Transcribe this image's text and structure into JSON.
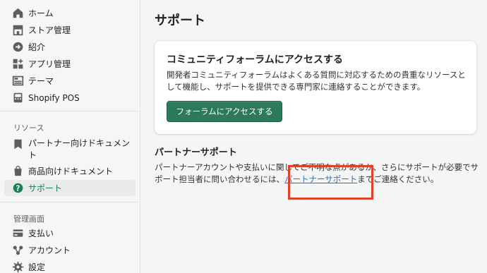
{
  "sidebar": {
    "items": [
      {
        "label": "ホーム",
        "icon": "home-icon"
      },
      {
        "label": "ストア管理",
        "icon": "store-icon"
      },
      {
        "label": "紹介",
        "icon": "referral-icon"
      },
      {
        "label": "アプリ管理",
        "icon": "apps-icon"
      },
      {
        "label": "テーマ",
        "icon": "theme-icon"
      },
      {
        "label": "Shopify POS",
        "icon": "pos-icon"
      }
    ],
    "resources_heading": "リソース",
    "resources": [
      {
        "label": "パートナー向けドキュメント",
        "icon": "document-icon"
      },
      {
        "label": "商品向けドキュメント",
        "icon": "shopping-bag-icon"
      },
      {
        "label": "サポート",
        "icon": "help-icon",
        "active": true
      }
    ],
    "admin_heading": "管理画面",
    "admin": [
      {
        "label": "支払い",
        "icon": "payment-icon"
      },
      {
        "label": "アカウント",
        "icon": "account-icon"
      },
      {
        "label": "設定",
        "icon": "gear-icon"
      }
    ]
  },
  "main": {
    "title": "サポート",
    "card": {
      "title": "コミュニティフォーラムにアクセスする",
      "body": "開発者コミュニティフォーラムはよくある質問に対応するための貴重なリソースとして機能し、サポートを提供できる専門家に連絡することができます。",
      "button_label": "フォーラムにアクセスする"
    },
    "partner_support": {
      "heading": "パートナーサポート",
      "text_before": "パートナーアカウントや支払いに関してご不明な点があるか、さらにサポートが必要でサポート担当者に問い合わせるには、",
      "link_label": "パートナーサポート",
      "text_after": "までご連絡ください。"
    }
  },
  "colors": {
    "accent": "#2c7a59",
    "active_text": "#1a7f55",
    "link": "#2c6ecb",
    "highlight": "#e0412a"
  }
}
